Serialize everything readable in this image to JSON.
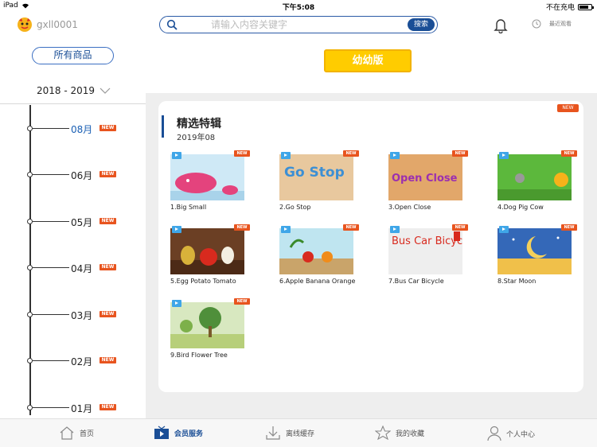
{
  "status_bar": {
    "device": "iPad",
    "time": "下午5:08",
    "charging": "不在充电",
    "battery_level": 0.8
  },
  "header": {
    "username": "gxll0001",
    "search": {
      "placeholder": "请输入内容关键字",
      "button": "搜索"
    },
    "recent_label": "最近观看"
  },
  "sidebar": {
    "all_products": "所有商品",
    "year": "2018 - 2019",
    "months": [
      {
        "label": "08月",
        "badge": "NEW",
        "active": true
      },
      {
        "label": "06月",
        "badge": "NEW",
        "active": false
      },
      {
        "label": "05月",
        "badge": "NEW",
        "active": false
      },
      {
        "label": "04月",
        "badge": "NEW",
        "active": false
      },
      {
        "label": "03月",
        "badge": "NEW",
        "active": false
      },
      {
        "label": "02月",
        "badge": "NEW",
        "active": false
      },
      {
        "label": "01月",
        "badge": "NEW",
        "active": false
      }
    ]
  },
  "main": {
    "level_button": "幼幼版",
    "card_badge": "NEW",
    "section_title": "精选特辑",
    "section_date": "2019年08",
    "items": [
      {
        "caption": "1.Big Small",
        "badge": "NEW",
        "thumb_text": ""
      },
      {
        "caption": "2.Go Stop",
        "badge": "NEW",
        "thumb_text": "Go Stop"
      },
      {
        "caption": "3.Open Close",
        "badge": "NEW",
        "thumb_text": "Open Close"
      },
      {
        "caption": "4.Dog Pig Cow",
        "badge": "NEW",
        "thumb_text": ""
      },
      {
        "caption": "5.Egg Potato Tomato",
        "badge": "NEW",
        "thumb_text": ""
      },
      {
        "caption": "6.Apple Banana Orange",
        "badge": "NEW",
        "thumb_text": ""
      },
      {
        "caption": "7.Bus Car Bicycle",
        "badge": "NEW",
        "thumb_text": "Bus Car Bicycle"
      },
      {
        "caption": "8.Star Moon",
        "badge": "NEW",
        "thumb_text": ""
      },
      {
        "caption": "9.Bird Flower Tree",
        "badge": "NEW",
        "thumb_text": ""
      }
    ]
  },
  "tabs": [
    {
      "label": "首页",
      "icon": "home-icon",
      "active": false
    },
    {
      "label": "会员服务",
      "icon": "tv-play-icon",
      "active": true
    },
    {
      "label": "离线缓存",
      "icon": "download-icon",
      "active": false
    },
    {
      "label": "我的收藏",
      "icon": "star-icon",
      "active": false
    },
    {
      "label": "个人中心",
      "icon": "person-icon",
      "active": false
    }
  ],
  "colors": {
    "accent": "#1a4e96",
    "new_badge": "#e8541e",
    "level_button": "#ffcc00"
  }
}
